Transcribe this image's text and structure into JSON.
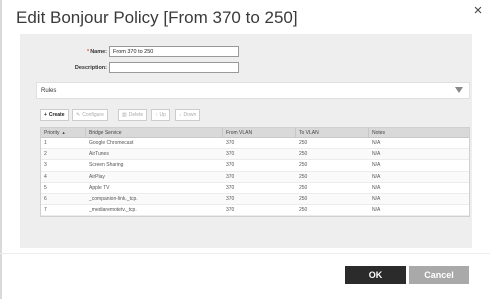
{
  "dialog": {
    "title": "Edit Bonjour Policy [From 370 to 250]",
    "close_glyph": "×"
  },
  "form": {
    "name_required": "*",
    "name_label": "Name:",
    "name_value": "From 370 to 250",
    "description_label": "Description:",
    "description_value": ""
  },
  "rules": {
    "label": "Rules"
  },
  "toolbar": {
    "create": "Create",
    "configure": "Configure",
    "delete": "Delete",
    "up": "Up",
    "down": "Down"
  },
  "grid": {
    "columns": [
      "Priority",
      "Bridge Service",
      "From VLAN",
      "To VLAN",
      "Notes"
    ],
    "sort_glyph": "▲",
    "rows": [
      [
        "1",
        "Google Chromecast",
        "370",
        "250",
        "N/A"
      ],
      [
        "2",
        "AirTunes",
        "370",
        "250",
        "N/A"
      ],
      [
        "3",
        "Screen Sharing",
        "370",
        "250",
        "N/A"
      ],
      [
        "4",
        "AirPlay",
        "370",
        "250",
        "N/A"
      ],
      [
        "5",
        "Apple TV",
        "370",
        "250",
        "N/A"
      ],
      [
        "6",
        "_companion-link._tcp.",
        "370",
        "250",
        "N/A"
      ],
      [
        "7",
        "_mediaremotetv._tcp.",
        "370",
        "250",
        "N/A"
      ]
    ]
  },
  "footer": {
    "ok": "OK",
    "cancel": "Cancel"
  }
}
